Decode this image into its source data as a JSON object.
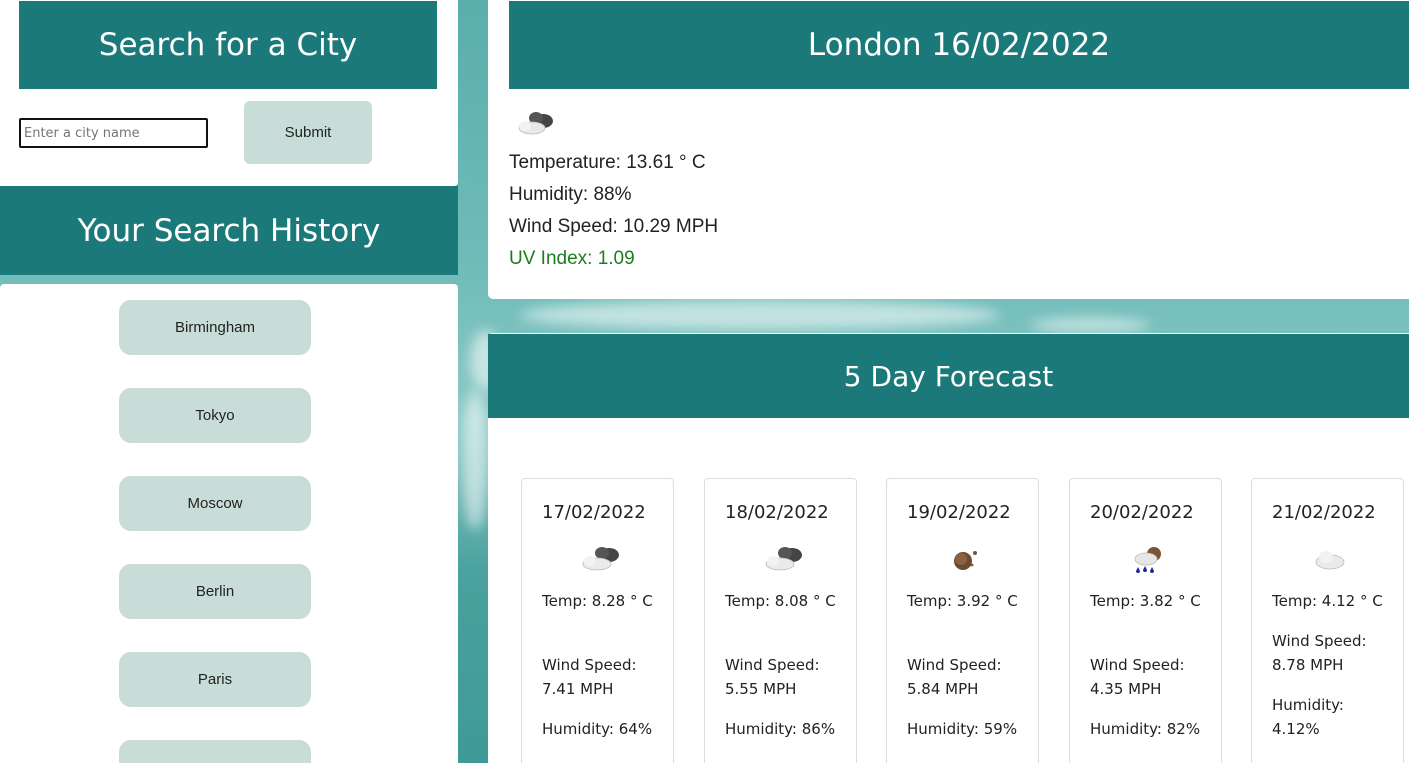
{
  "search": {
    "title": "Search for a City",
    "placeholder": "Enter a city name",
    "submit_label": "Submit"
  },
  "history": {
    "title": "Your Search History",
    "items": [
      {
        "label": "Birmingham"
      },
      {
        "label": "Tokyo"
      },
      {
        "label": "Moscow"
      },
      {
        "label": "Berlin"
      },
      {
        "label": "Paris"
      },
      {
        "label": ""
      }
    ]
  },
  "current": {
    "title": "London 16/02/2022",
    "icon": "cloudy-icon",
    "temperature": "Temperature: 13.61 ° C",
    "humidity": "Humidity: 88%",
    "wind": "Wind Speed: 10.29 MPH",
    "uv": "UV Index: 1.09",
    "uv_color": "#1e7d1e"
  },
  "forecast": {
    "title": "5 Day Forecast",
    "days": [
      {
        "date": "17/02/2022",
        "icon": "broken-clouds-icon",
        "temp": "Temp: 8.28 ° C",
        "wind": "Wind Speed: 7.41 MPH",
        "humidity": "Humidity: 64%"
      },
      {
        "date": "18/02/2022",
        "icon": "broken-clouds-icon",
        "temp": "Temp: 8.08 ° C",
        "wind": "Wind Speed: 5.55 MPH",
        "humidity": "Humidity: 86%"
      },
      {
        "date": "19/02/2022",
        "icon": "moon-icon",
        "temp": "Temp: 3.92 ° C",
        "wind": "Wind Speed: 5.84 MPH",
        "humidity": "Humidity: 59%"
      },
      {
        "date": "20/02/2022",
        "icon": "rain-icon",
        "temp": "Temp: 3.82 ° C",
        "wind": "Wind Speed: 4.35 MPH",
        "humidity": "Humidity: 82%"
      },
      {
        "date": "21/02/2022",
        "icon": "cloud-icon",
        "temp": "Temp: 4.12 ° C",
        "wind": "Wind Speed: 8.78 MPH",
        "humidity": "Humidity: 4.12%"
      }
    ]
  },
  "colors": {
    "header_teal": "#1b7a79",
    "button_bg": "#c8dcd8"
  }
}
